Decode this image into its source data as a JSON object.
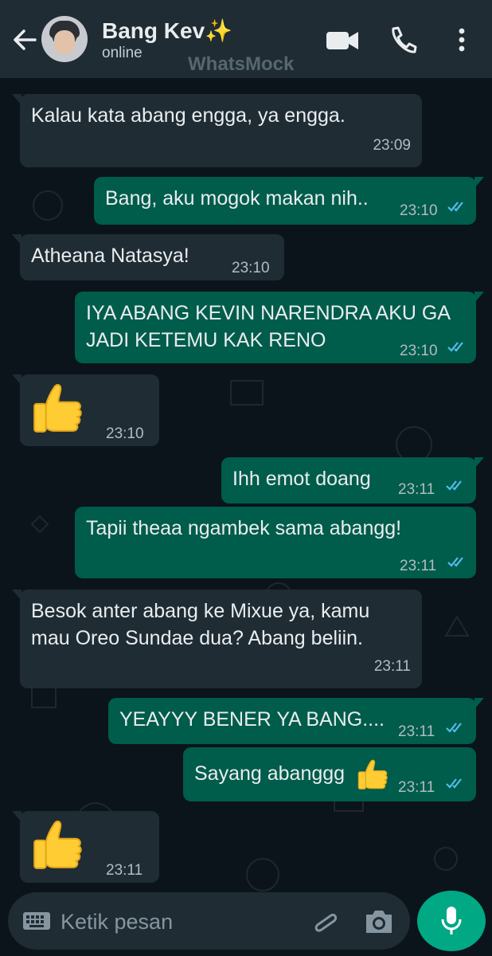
{
  "header": {
    "contact_name": "Bang Kev✨",
    "status": "online",
    "watermark": "WhatsMock",
    "icons": [
      "back-arrow-icon",
      "video-call-icon",
      "phone-icon",
      "more-options-icon"
    ]
  },
  "messages": [
    {
      "direction": "in",
      "text": "Kalau kata abang engga, ya engga.",
      "time": "23:09"
    },
    {
      "direction": "out",
      "text": "Bang, aku mogok makan nih..",
      "time": "23:10",
      "status": "read"
    },
    {
      "direction": "in",
      "text": "Atheana Natasya!",
      "time": "23:10"
    },
    {
      "direction": "out",
      "text": "IYA ABANG KEVIN NARENDRA AKU GA\nJADI KETEMU KAK RENO",
      "time": "23:10",
      "status": "read"
    },
    {
      "direction": "in",
      "emoji": "thumbs-up",
      "time": "23:10"
    },
    {
      "direction": "out",
      "text": "Ihh emot doang",
      "time": "23:11",
      "status": "read"
    },
    {
      "direction": "out",
      "text": "Tapii theaa ngambek sama abangg!",
      "time": "23:11",
      "status": "read"
    },
    {
      "direction": "in",
      "text": "Besok anter abang ke Mixue ya, kamu\nmau Oreo Sundae dua? Abang beliin.",
      "time": "23:11"
    },
    {
      "direction": "out",
      "text": "YEAYYY BENER YA BANG....",
      "time": "23:11",
      "status": "read"
    },
    {
      "direction": "out",
      "text": "Sayang abanggg",
      "emoji": "thumbs-up",
      "time": "23:11",
      "status": "read"
    },
    {
      "direction": "in",
      "emoji": "thumbs-up",
      "time": "23:11"
    }
  ],
  "composer": {
    "placeholder": "Ketik pesan",
    "icons": [
      "keyboard-icon",
      "attachment-icon",
      "camera-icon",
      "microphone-icon"
    ]
  },
  "colors": {
    "background": "#0b141a",
    "header": "#1f2c34",
    "incoming_bubble": "#1f2c34",
    "outgoing_bubble": "#005c4b",
    "read_ticks": "#53bdeb",
    "mic_button": "#00a884"
  }
}
